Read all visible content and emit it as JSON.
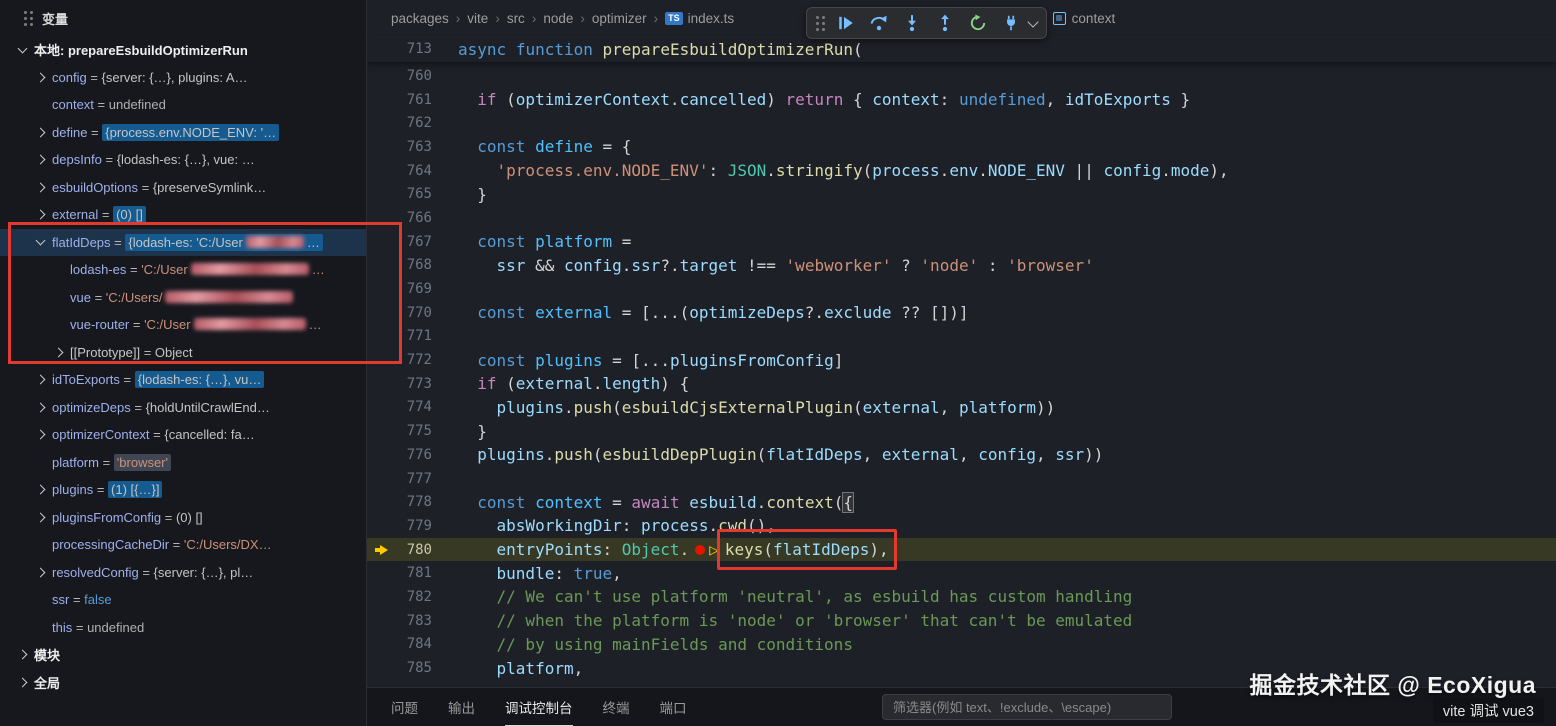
{
  "icons": {
    "breadcrumb_sep": "›",
    "ts_badge": "TS",
    "col_marker": "▷"
  },
  "sidebar": {
    "title": "变量",
    "variables": [
      {
        "scope": true,
        "name": "本地: prepareEsbuildOptimizerRun",
        "expand": "down",
        "depth": 0
      },
      {
        "name": "config",
        "value": "{server: {…}, plugins: A…",
        "expand": "right",
        "depth": 1
      },
      {
        "name": "context",
        "value": "undefined",
        "depth": 1,
        "value_class": "muted"
      },
      {
        "name": "define",
        "value": "{process.env.NODE_ENV: '…",
        "expand": "right",
        "depth": 1,
        "hl": "blue"
      },
      {
        "name": "depsInfo",
        "value": "{lodash-es: {…}, vue: …",
        "expand": "right",
        "depth": 1
      },
      {
        "name": "esbuildOptions",
        "value": "{preserveSymlink…",
        "expand": "right",
        "depth": 1
      },
      {
        "name": "external",
        "value": "(0) []",
        "expand": "right",
        "depth": 1,
        "hl": "blue"
      },
      {
        "name": "flatIdDeps",
        "value": "{lodash-es: 'C:/User",
        "expand": "down",
        "depth": 1,
        "hl": "blue",
        "selected": true,
        "redacted": true,
        "redact_width": 58,
        "tail": "…"
      },
      {
        "name": "lodash-es",
        "value": "'C:/User",
        "depth": 2,
        "value_class": "str",
        "redacted": true,
        "redact_width": 118,
        "tail": "…"
      },
      {
        "name": "vue",
        "value": "'C:/Users/",
        "depth": 2,
        "value_class": "str",
        "redacted": true,
        "redact_width": 128
      },
      {
        "name": "vue-router",
        "value": "'C:/User",
        "depth": 2,
        "value_class": "str",
        "redacted": true,
        "redact_width": 112,
        "tail": "…"
      },
      {
        "name": "[[Prototype]]",
        "value": "Object",
        "expand": "right",
        "depth": 2,
        "name_class": "proto"
      },
      {
        "name": "idToExports",
        "value": "{lodash-es: {…}, vu…",
        "expand": "right",
        "depth": 1,
        "hl": "blue"
      },
      {
        "name": "optimizeDeps",
        "value": "{holdUntilCrawlEnd…",
        "expand": "right",
        "depth": 1
      },
      {
        "name": "optimizerContext",
        "value": "{cancelled: fa…",
        "expand": "right",
        "depth": 1
      },
      {
        "name": "platform",
        "value": "'browser'",
        "depth": 1,
        "value_class": "str",
        "hl": "gray"
      },
      {
        "name": "plugins",
        "value": "(1) [{…}]",
        "expand": "right",
        "depth": 1,
        "hl": "blue"
      },
      {
        "name": "pluginsFromConfig",
        "value": "(0) []",
        "expand": "right",
        "depth": 1
      },
      {
        "name": "processingCacheDir",
        "value": "'C:/Users/DX…",
        "depth": 1,
        "value_class": "str"
      },
      {
        "name": "resolvedConfig",
        "value": "{server: {…}, pl…",
        "expand": "right",
        "depth": 1
      },
      {
        "name": "ssr",
        "value": "false",
        "depth": 1,
        "value_class": "bool"
      },
      {
        "name": "this",
        "value": "undefined",
        "depth": 1,
        "value_class": "muted"
      },
      {
        "scope": true,
        "name": "模块",
        "expand": "right",
        "depth": 0
      },
      {
        "scope": true,
        "name": "全局",
        "expand": "right",
        "depth": 0
      }
    ]
  },
  "breadcrumb": {
    "items": [
      {
        "label": "packages"
      },
      {
        "label": "vite"
      },
      {
        "label": "src"
      },
      {
        "label": "node"
      },
      {
        "label": "optimizer"
      },
      {
        "label": "index.ts",
        "icon": "ts"
      },
      {
        "label": "context",
        "icon": "symbol",
        "gap": true
      }
    ]
  },
  "debug_toolbar": {
    "buttons": [
      "continue",
      "step-over",
      "step-into",
      "step-out",
      "restart",
      "disconnect"
    ]
  },
  "editor": {
    "sticky_line": {
      "n": 713,
      "t": [
        [
          "kw",
          "async"
        ],
        [
          "pun",
          " "
        ],
        [
          "kw",
          "function"
        ],
        [
          "pun",
          " "
        ],
        [
          "fn",
          "prepareEsbuildOptimizerRun"
        ],
        [
          "pun",
          "("
        ]
      ]
    },
    "lines": [
      {
        "n": 760,
        "t": []
      },
      {
        "n": 761,
        "t": [
          [
            "pun",
            "  "
          ],
          [
            "ctrl",
            "if"
          ],
          [
            "pun",
            " ("
          ],
          [
            "var",
            "optimizerContext"
          ],
          [
            "pun",
            "."
          ],
          [
            "var",
            "cancelled"
          ],
          [
            "pun",
            ") "
          ],
          [
            "ctrl",
            "return"
          ],
          [
            "pun",
            " { "
          ],
          [
            "var",
            "context"
          ],
          [
            "pun",
            ": "
          ],
          [
            "kw",
            "undefined"
          ],
          [
            "pun",
            ", "
          ],
          [
            "var",
            "idToExports"
          ],
          [
            "pun",
            " }"
          ]
        ]
      },
      {
        "n": 762,
        "t": []
      },
      {
        "n": 763,
        "t": [
          [
            "pun",
            "  "
          ],
          [
            "kw",
            "const"
          ],
          [
            "pun",
            " "
          ],
          [
            "constvar",
            "define"
          ],
          [
            "pun",
            " = {"
          ]
        ]
      },
      {
        "n": 764,
        "t": [
          [
            "pun",
            "    "
          ],
          [
            "str",
            "'process.env.NODE_ENV'"
          ],
          [
            "pun",
            ": "
          ],
          [
            "cls",
            "JSON"
          ],
          [
            "pun",
            "."
          ],
          [
            "fn",
            "stringify"
          ],
          [
            "pun",
            "("
          ],
          [
            "var",
            "process"
          ],
          [
            "pun",
            "."
          ],
          [
            "var",
            "env"
          ],
          [
            "pun",
            "."
          ],
          [
            "var",
            "NODE_ENV"
          ],
          [
            "pun",
            " || "
          ],
          [
            "var",
            "config"
          ],
          [
            "pun",
            "."
          ],
          [
            "var",
            "mode"
          ],
          [
            "pun",
            "),"
          ]
        ]
      },
      {
        "n": 765,
        "t": [
          [
            "pun",
            "  }"
          ]
        ]
      },
      {
        "n": 766,
        "t": []
      },
      {
        "n": 767,
        "t": [
          [
            "pun",
            "  "
          ],
          [
            "kw",
            "const"
          ],
          [
            "pun",
            " "
          ],
          [
            "constvar",
            "platform"
          ],
          [
            "pun",
            " ="
          ]
        ]
      },
      {
        "n": 768,
        "t": [
          [
            "pun",
            "    "
          ],
          [
            "var",
            "ssr"
          ],
          [
            "pun",
            " && "
          ],
          [
            "var",
            "config"
          ],
          [
            "pun",
            "."
          ],
          [
            "var",
            "ssr"
          ],
          [
            "pun",
            "?."
          ],
          [
            "var",
            "target"
          ],
          [
            "pun",
            " !== "
          ],
          [
            "str",
            "'webworker'"
          ],
          [
            "pun",
            " ? "
          ],
          [
            "str",
            "'node'"
          ],
          [
            "pun",
            " : "
          ],
          [
            "str",
            "'browser'"
          ]
        ]
      },
      {
        "n": 769,
        "t": []
      },
      {
        "n": 770,
        "t": [
          [
            "pun",
            "  "
          ],
          [
            "kw",
            "const"
          ],
          [
            "pun",
            " "
          ],
          [
            "constvar",
            "external"
          ],
          [
            "pun",
            " = [...("
          ],
          [
            "var",
            "optimizeDeps"
          ],
          [
            "pun",
            "?."
          ],
          [
            "var",
            "exclude"
          ],
          [
            "pun",
            " ?? [])]"
          ]
        ]
      },
      {
        "n": 771,
        "t": []
      },
      {
        "n": 772,
        "t": [
          [
            "pun",
            "  "
          ],
          [
            "kw",
            "const"
          ],
          [
            "pun",
            " "
          ],
          [
            "constvar",
            "plugins"
          ],
          [
            "pun",
            " = [..."
          ],
          [
            "var",
            "pluginsFromConfig"
          ],
          [
            "pun",
            "]"
          ]
        ]
      },
      {
        "n": 773,
        "t": [
          [
            "pun",
            "  "
          ],
          [
            "ctrl",
            "if"
          ],
          [
            "pun",
            " ("
          ],
          [
            "var",
            "external"
          ],
          [
            "pun",
            "."
          ],
          [
            "var",
            "length"
          ],
          [
            "pun",
            ") {"
          ]
        ]
      },
      {
        "n": 774,
        "t": [
          [
            "pun",
            "    "
          ],
          [
            "var",
            "plugins"
          ],
          [
            "pun",
            "."
          ],
          [
            "fn",
            "push"
          ],
          [
            "pun",
            "("
          ],
          [
            "fn",
            "esbuildCjsExternalPlugin"
          ],
          [
            "pun",
            "("
          ],
          [
            "var",
            "external"
          ],
          [
            "pun",
            ", "
          ],
          [
            "var",
            "platform"
          ],
          [
            "pun",
            "))"
          ]
        ]
      },
      {
        "n": 775,
        "t": [
          [
            "pun",
            "  }"
          ]
        ]
      },
      {
        "n": 776,
        "t": [
          [
            "pun",
            "  "
          ],
          [
            "var",
            "plugins"
          ],
          [
            "pun",
            "."
          ],
          [
            "fn",
            "push"
          ],
          [
            "pun",
            "("
          ],
          [
            "fn",
            "esbuildDepPlugin"
          ],
          [
            "pun",
            "("
          ],
          [
            "var",
            "flatIdDeps"
          ],
          [
            "pun",
            ", "
          ],
          [
            "var",
            "external"
          ],
          [
            "pun",
            ", "
          ],
          [
            "var",
            "config"
          ],
          [
            "pun",
            ", "
          ],
          [
            "var",
            "ssr"
          ],
          [
            "pun",
            "))"
          ]
        ]
      },
      {
        "n": 777,
        "t": []
      },
      {
        "n": 778,
        "t": [
          [
            "pun",
            "  "
          ],
          [
            "kw",
            "const"
          ],
          [
            "pun",
            " "
          ],
          [
            "constvar",
            "context"
          ],
          [
            "pun",
            " = "
          ],
          [
            "ctrl",
            "await"
          ],
          [
            "pun",
            " "
          ],
          [
            "var",
            "esbuild"
          ],
          [
            "pun",
            "."
          ],
          [
            "fn",
            "context"
          ],
          [
            "pun",
            "("
          ],
          [
            "bracket",
            "{"
          ]
        ]
      },
      {
        "n": 779,
        "t": [
          [
            "pun",
            "    "
          ],
          [
            "var",
            "absWorkingDir"
          ],
          [
            "pun",
            ": "
          ],
          [
            "var",
            "process"
          ],
          [
            "pun",
            "."
          ],
          [
            "fn",
            "cwd"
          ],
          [
            "pun",
            "(),"
          ]
        ]
      },
      {
        "n": 780,
        "current": true,
        "t": [
          [
            "pun",
            "    "
          ],
          [
            "var",
            "entryPoints"
          ],
          [
            "pun",
            ": "
          ],
          [
            "cls",
            "Object"
          ],
          [
            "pun",
            "."
          ],
          [
            "icon-bp",
            ""
          ],
          [
            "icon-col",
            ""
          ],
          [
            "fn",
            "keys",
            "redbox"
          ],
          [
            "pun",
            "(",
            "redbox"
          ],
          [
            "var",
            "flatIdDeps",
            "redbox"
          ],
          [
            "pun",
            "),",
            "redbox"
          ]
        ]
      },
      {
        "n": 781,
        "t": [
          [
            "pun",
            "    "
          ],
          [
            "var",
            "bundle"
          ],
          [
            "pun",
            ": "
          ],
          [
            "kw",
            "true"
          ],
          [
            "pun",
            ","
          ]
        ]
      },
      {
        "n": 782,
        "t": [
          [
            "cmt",
            "    // We can't use platform 'neutral', as esbuild has custom handling"
          ]
        ]
      },
      {
        "n": 783,
        "t": [
          [
            "cmt",
            "    // when the platform is 'node' or 'browser' that can't be emulated"
          ]
        ]
      },
      {
        "n": 784,
        "t": [
          [
            "cmt",
            "    // by using mainFields and conditions"
          ]
        ]
      },
      {
        "n": 785,
        "t": [
          [
            "pun",
            "    "
          ],
          [
            "var",
            "platform"
          ],
          [
            "pun",
            ","
          ]
        ]
      }
    ]
  },
  "panel": {
    "tabs": [
      "问题",
      "输出",
      "调试控制台",
      "终端",
      "端口"
    ],
    "active_index": 2,
    "filter_placeholder": "筛选器(例如 text、!exclude、\\escape)"
  },
  "watermark": {
    "text": "掘金技术社区 @ EcoXigua",
    "badge": "vite 调试 vue3"
  }
}
